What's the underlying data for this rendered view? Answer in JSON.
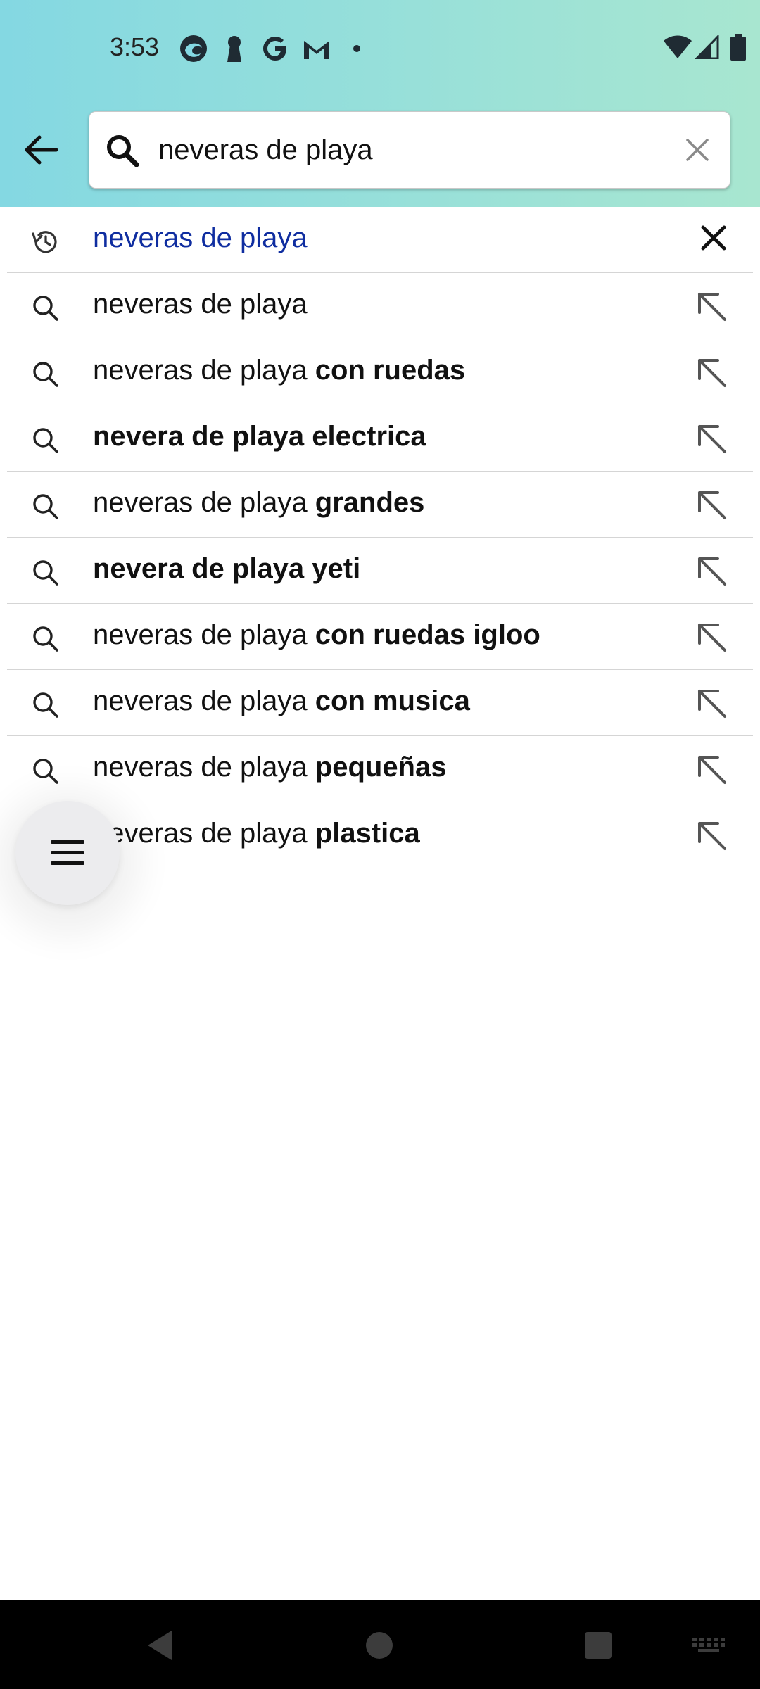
{
  "status_bar": {
    "time": "3:53",
    "notification_icons": [
      "edge-browser-icon",
      "keyhole-icon",
      "google-icon",
      "gmail-icon",
      "dot-icon"
    ],
    "system_icons": [
      "wifi-icon",
      "cellular-signal-icon",
      "battery-icon"
    ]
  },
  "search": {
    "value": "neveras de playa",
    "placeholder": ""
  },
  "suggestions": [
    {
      "type": "history",
      "prefix": "neveras de playa",
      "bold": ""
    },
    {
      "type": "search",
      "prefix": "neveras de playa",
      "bold": ""
    },
    {
      "type": "search",
      "prefix": "neveras de playa ",
      "bold": "con ruedas"
    },
    {
      "type": "search",
      "prefix": "",
      "bold": "nevera de playa electrica"
    },
    {
      "type": "search",
      "prefix": "neveras de playa ",
      "bold": "grandes"
    },
    {
      "type": "search",
      "prefix": "",
      "bold": "nevera de playa yeti"
    },
    {
      "type": "search",
      "prefix": "neveras de playa ",
      "bold": "con ruedas igloo"
    },
    {
      "type": "search",
      "prefix": "neveras de playa ",
      "bold": "con musica"
    },
    {
      "type": "search",
      "prefix": "neveras de playa ",
      "bold": "pequeñas"
    },
    {
      "type": "search",
      "prefix": "neveras de playa ",
      "bold": "plastica"
    }
  ],
  "colors": {
    "history_text": "#0f2da0",
    "header_gradient_start": "#84d8e2",
    "header_gradient_end": "#a8e6d0"
  },
  "fab": {
    "icon": "hamburger-menu-icon"
  },
  "nav_bar": {
    "icons": [
      "nav-back-icon",
      "nav-home-icon",
      "nav-recents-icon",
      "keyboard-icon"
    ]
  }
}
